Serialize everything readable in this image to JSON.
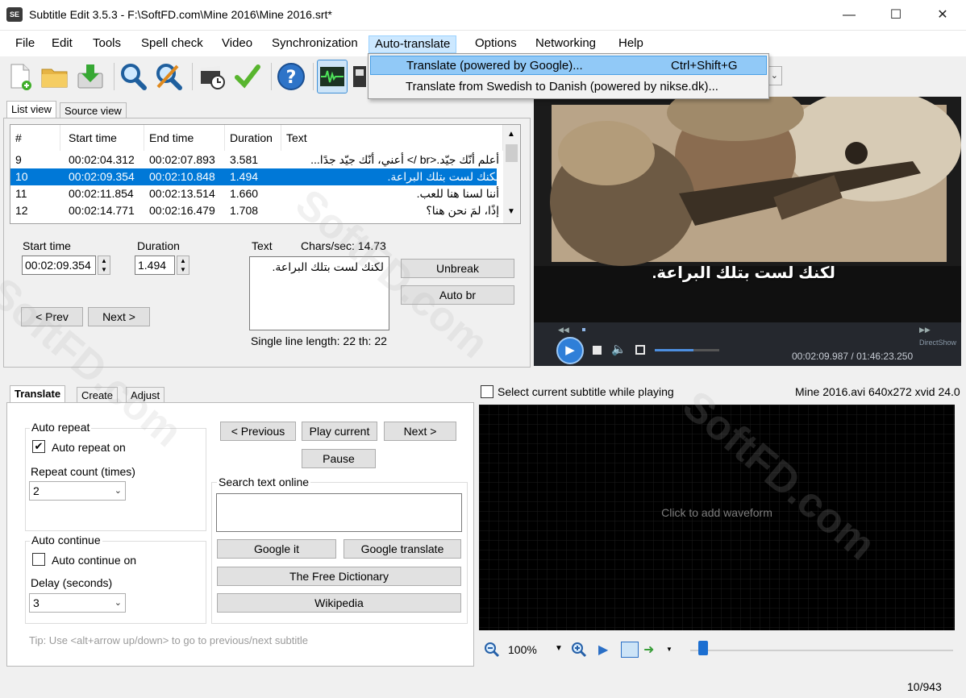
{
  "window": {
    "title": "Subtitle Edit 3.5.3 - F:\\SoftFD.com\\Mine 2016\\Mine 2016.srt*",
    "app_icon": "SE"
  },
  "menu": [
    "File",
    "Edit",
    "Tools",
    "Spell check",
    "Video",
    "Synchronization",
    "Auto-translate",
    "Options",
    "Networking",
    "Help"
  ],
  "dropdown": {
    "items": [
      {
        "label": "Translate (powered by Google)...",
        "shortcut": "Ctrl+Shift+G"
      },
      {
        "label": "Translate from Swedish to Danish (powered by nikse.dk)...",
        "shortcut": ""
      }
    ]
  },
  "toolbar": {
    "icons": [
      "new-file-icon",
      "open-folder-icon",
      "save-icon",
      "find-icon",
      "replace-icon",
      "visual-sync-icon",
      "spell-check-icon",
      "help-icon",
      "waveform-toggle-icon",
      "video-toggle-icon"
    ]
  },
  "list_tabs": [
    "List view",
    "Source view"
  ],
  "list": {
    "columns": [
      "#",
      "Start time",
      "End time",
      "Duration",
      "Text"
    ],
    "rows": [
      {
        "num": "9",
        "start": "00:02:04.312",
        "end": "00:02:07.893",
        "duration": "3.581",
        "text": "أعلم أنّك جيّد.<br /> أعني، أنّك جيّد جدًا...",
        "selected": false
      },
      {
        "num": "10",
        "start": "00:02:09.354",
        "end": "00:02:10.848",
        "duration": "1.494",
        "text": "لكنك لست بتلك البراعة.",
        "selected": true
      },
      {
        "num": "11",
        "start": "00:02:11.854",
        "end": "00:02:13.514",
        "duration": "1.660",
        "text": "أننا لسنا هنا للعب.",
        "selected": false
      },
      {
        "num": "12",
        "start": "00:02:14.771",
        "end": "00:02:16.479",
        "duration": "1.708",
        "text": "إذًا، لمَ نحن هنا؟",
        "selected": false
      }
    ]
  },
  "edit": {
    "start_time_label": "Start time",
    "start_time_value": "00:02:09.354",
    "duration_label": "Duration",
    "duration_value": "1.494",
    "text_label": "Text",
    "chars_sec": "Chars/sec: 14.73",
    "text_value": "لكنك لست بتلك البراعة.",
    "unbreak": "Unbreak",
    "auto_br": "Auto br",
    "prev": "< Prev",
    "next": "Next >",
    "line_length": "Single line length: 22 th: 22"
  },
  "video": {
    "subtitle": "لكنك لست بتلك البراعة.",
    "time": "00:02:09.987 / 01:46:23.250",
    "engine": "DirectShow",
    "progress": 0.02,
    "volume": 0.6
  },
  "bottom_tabs": [
    "Translate",
    "Create",
    "Adjust"
  ],
  "translate": {
    "auto_repeat_group": "Auto repeat",
    "auto_repeat_on": "Auto repeat on",
    "auto_repeat_checked": true,
    "repeat_count_label": "Repeat count (times)",
    "repeat_count": "2",
    "auto_continue_group": "Auto continue",
    "auto_continue_on": "Auto continue on",
    "auto_continue_checked": false,
    "delay_label": "Delay (seconds)",
    "delay": "3",
    "previous": "< Previous",
    "play_current": "Play current",
    "next": "Next >",
    "pause": "Pause",
    "search_online": "Search text online",
    "google_it": "Google it",
    "google_translate": "Google translate",
    "free_dictionary": "The Free Dictionary",
    "wikipedia": "Wikipedia",
    "tip": "Tip: Use <alt+arrow up/down> to go to previous/next subtitle"
  },
  "waveform": {
    "select_current": "Select current subtitle while playing",
    "video_info": "Mine 2016.avi 640x272 xvid 24.0",
    "placeholder": "Click to add waveform",
    "zoom": "100%",
    "position": 0.03
  },
  "status": {
    "count": "10/943"
  },
  "watermark": "SoftFD.com"
}
